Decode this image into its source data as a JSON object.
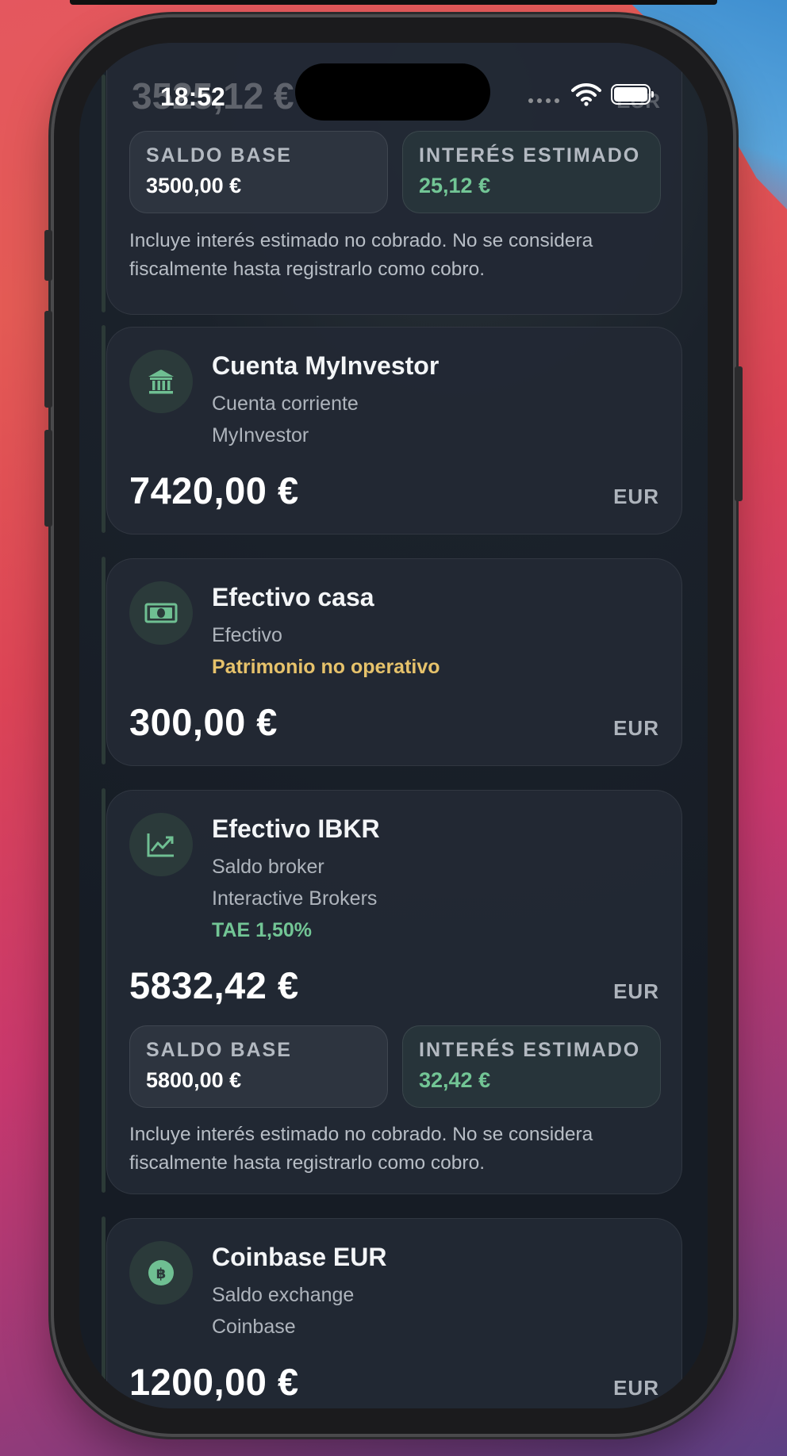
{
  "status_bar": {
    "time": "18:52",
    "cellular_icon": "signal-dots-icon",
    "wifi_icon": "wifi-icon",
    "battery_icon": "battery-icon"
  },
  "scrolled_header": {
    "amount": "3525,12 €",
    "currency": "EUR"
  },
  "first_card_tail": {
    "base_label": "SALDO BASE",
    "base_value": "3500,00 €",
    "interest_label": "INTERÉS ESTIMADO",
    "interest_value": "25,12 €",
    "note": "Incluye interés estimado no cobrado. No se considera fiscalmente hasta registrarlo como cobro."
  },
  "accounts": [
    {
      "icon": "bank-icon",
      "name": "Cuenta MyInvestor",
      "type": "Cuenta corriente",
      "institution": "MyInvestor",
      "amount": "7420,00 €",
      "currency": "EUR"
    },
    {
      "icon": "banknote-icon",
      "name": "Efectivo casa",
      "type": "Efectivo",
      "flag": "Patrimonio no operativo",
      "amount": "300,00 €",
      "currency": "EUR"
    },
    {
      "icon": "chart-trend-icon",
      "name": "Efectivo IBKR",
      "type": "Saldo broker",
      "institution": "Interactive Brokers",
      "rate": "TAE 1,50%",
      "amount": "5832,42 €",
      "currency": "EUR",
      "base_label": "SALDO BASE",
      "base_value": "5800,00 €",
      "interest_label": "INTERÉS ESTIMADO",
      "interest_value": "32,42 €",
      "note": "Incluye interés estimado no cobrado. No se considera fiscalmente hasta registrarlo como cobro."
    },
    {
      "icon": "bitcoin-icon",
      "name": "Coinbase EUR",
      "type": "Saldo exchange",
      "institution": "Coinbase",
      "amount": "1200,00 €",
      "currency": "EUR"
    }
  ],
  "colors": {
    "accent_green": "#72c595",
    "warning_yellow": "#e6c26b",
    "card": "#222934",
    "screen": "#171d26"
  }
}
